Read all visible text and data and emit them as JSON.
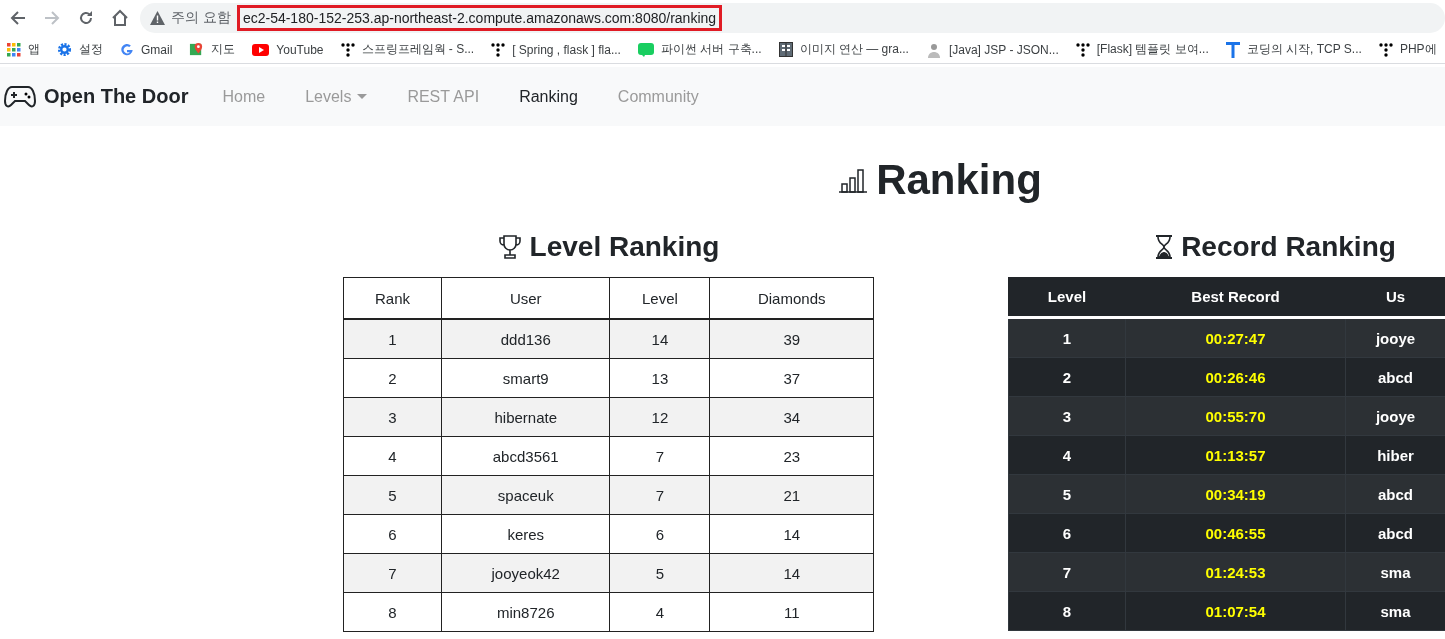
{
  "browser": {
    "warning": "주의 요함",
    "url": "ec2-54-180-152-253.ap-northeast-2.compute.amazonaws.com:8080/ranking",
    "bookmarks": [
      {
        "label": "앱"
      },
      {
        "label": "설정"
      },
      {
        "label": "Gmail"
      },
      {
        "label": "지도"
      },
      {
        "label": "YouTube"
      },
      {
        "label": "스프링프레임웍 - S..."
      },
      {
        "label": "[ Spring , flask ] fla..."
      },
      {
        "label": "파이썬 서버 구축..."
      },
      {
        "label": "이미지 연산 — gra..."
      },
      {
        "label": "[Java] JSP - JSON..."
      },
      {
        "label": "[Flask] 템플릿 보여..."
      },
      {
        "label": "코딩의 시작, TCP S..."
      },
      {
        "label": "PHP에"
      }
    ]
  },
  "navbar": {
    "brand": "Open The Door",
    "items": [
      {
        "label": "Home",
        "selected": false,
        "has_menu": false
      },
      {
        "label": "Levels",
        "selected": false,
        "has_menu": true
      },
      {
        "label": "REST API",
        "selected": false,
        "has_menu": false
      },
      {
        "label": "Ranking",
        "selected": true,
        "has_menu": false
      },
      {
        "label": "Community",
        "selected": false,
        "has_menu": false
      }
    ]
  },
  "page_title": "Ranking",
  "level_ranking": {
    "title": "Level Ranking",
    "columns": [
      "Rank",
      "User",
      "Level",
      "Diamonds"
    ],
    "rows": [
      [
        "1",
        "ddd136",
        "14",
        "39"
      ],
      [
        "2",
        "smart9",
        "13",
        "37"
      ],
      [
        "3",
        "hibernate",
        "12",
        "34"
      ],
      [
        "4",
        "abcd3561",
        "7",
        "23"
      ],
      [
        "5",
        "spaceuk",
        "7",
        "21"
      ],
      [
        "6",
        "keres",
        "6",
        "14"
      ],
      [
        "7",
        "jooyeok42",
        "5",
        "14"
      ],
      [
        "8",
        "min8726",
        "4",
        "11"
      ]
    ]
  },
  "record_ranking": {
    "title": "Record Ranking",
    "columns": [
      "Level",
      "Best Record",
      "Us"
    ],
    "rows": [
      [
        "1",
        "00:27:47",
        "jooye"
      ],
      [
        "2",
        "00:26:46",
        "abcd"
      ],
      [
        "3",
        "00:55:70",
        "jooye"
      ],
      [
        "4",
        "01:13:57",
        "hiber"
      ],
      [
        "5",
        "00:34:19",
        "abcd"
      ],
      [
        "6",
        "00:46:55",
        "abcd"
      ],
      [
        "7",
        "01:24:53",
        "sma"
      ],
      [
        "8",
        "01:07:54",
        "sma"
      ]
    ]
  }
}
